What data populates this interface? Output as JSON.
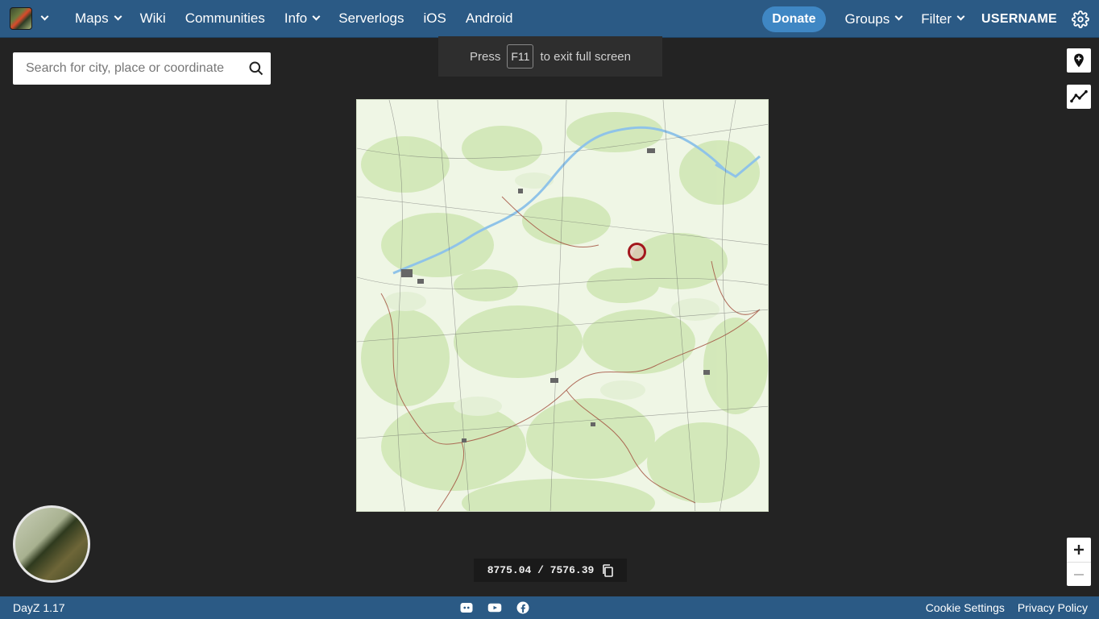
{
  "navbar": {
    "items": [
      {
        "label": "Maps",
        "dropdown": true
      },
      {
        "label": "Wiki",
        "dropdown": false
      },
      {
        "label": "Communities",
        "dropdown": false
      },
      {
        "label": "Info",
        "dropdown": true
      },
      {
        "label": "Serverlogs",
        "dropdown": false
      },
      {
        "label": "iOS",
        "dropdown": false
      },
      {
        "label": "Android",
        "dropdown": false
      }
    ],
    "donate": "Donate",
    "groups": "Groups",
    "filter": "Filter",
    "username": "USERNAME"
  },
  "search": {
    "placeholder": "Search for city, place or coordinate"
  },
  "fullscreen_hint": {
    "before": "Press",
    "key": "F11",
    "after": "to exit full screen"
  },
  "coords": "8775.04 / 7576.39",
  "footer": {
    "version": "DayZ 1.17",
    "cookie": "Cookie Settings",
    "privacy": "Privacy Policy"
  },
  "colors": {
    "navbar": "#2b5a85",
    "donate": "#3f87c4",
    "marker": "#a3161c",
    "background": "#232323"
  }
}
